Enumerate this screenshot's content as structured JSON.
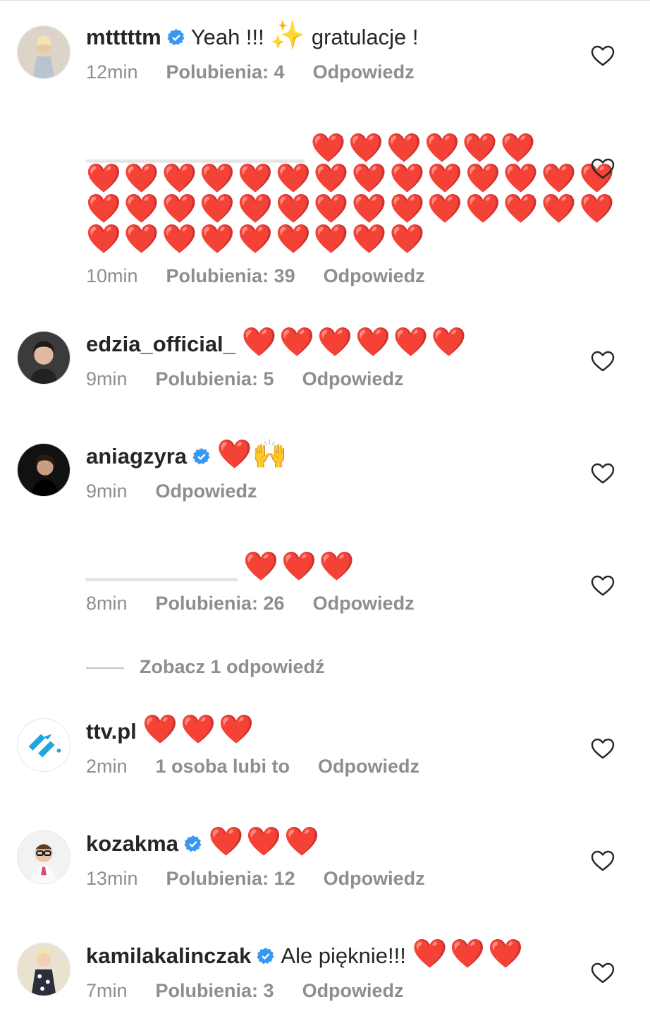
{
  "comments": [
    {
      "username": "mtttttm",
      "verified": true,
      "text": "Yeah !!!",
      "emoji": "✨",
      "text2": "gratulacje !",
      "time": "12min",
      "likes": "Polubienia: 4",
      "reply": "Odpowiedz"
    },
    {
      "username": "",
      "verified": false,
      "hearts_line1": "❤️❤️❤️❤️❤️❤️",
      "hearts_line2": "❤️❤️❤️❤️❤️❤️❤️❤️❤️❤️❤️❤️❤️❤️",
      "hearts_line3": "❤️❤️❤️❤️❤️❤️❤️❤️❤️❤️❤️❤️❤️❤️",
      "hearts_line4": "❤️❤️❤️❤️❤️❤️❤️❤️❤️",
      "time": "10min",
      "likes": "Polubienia: 39",
      "reply": "Odpowiedz"
    },
    {
      "username": "edzia_official_",
      "verified": false,
      "hearts": "❤️❤️❤️❤️❤️❤️",
      "time": "9min",
      "likes": "Polubienia: 5",
      "reply": "Odpowiedz"
    },
    {
      "username": "aniagzyra",
      "verified": true,
      "emoji": "❤️🙌",
      "time": "9min",
      "reply": "Odpowiedz"
    },
    {
      "username": "",
      "verified": false,
      "hearts": "❤️❤️❤️",
      "time": "8min",
      "likes": "Polubienia: 26",
      "reply": "Odpowiedz"
    },
    {
      "username": "ttv.pl",
      "verified": false,
      "hearts": "❤️❤️❤️",
      "time": "2min",
      "likes": "1 osoba lubi to",
      "reply": "Odpowiedz"
    },
    {
      "username": "kozakma",
      "verified": true,
      "hearts": "❤️❤️❤️",
      "time": "13min",
      "likes": "Polubienia: 12",
      "reply": "Odpowiedz"
    },
    {
      "username": "kamilakalinczak",
      "verified": true,
      "text": "Ale pięknie!!!",
      "hearts": "❤️❤️❤️",
      "time": "7min",
      "likes": "Polubienia: 3",
      "reply": "Odpowiedz"
    }
  ],
  "view_replies": "Zobacz 1 odpowiedź",
  "colors": {
    "verified": "#3897f0",
    "heart": "#e8231f",
    "meta": "#8e8e8e",
    "ttv_brand": "#1ea7dc"
  },
  "icons": {
    "like": "heart-outline-icon",
    "verified": "verified-badge-icon"
  }
}
